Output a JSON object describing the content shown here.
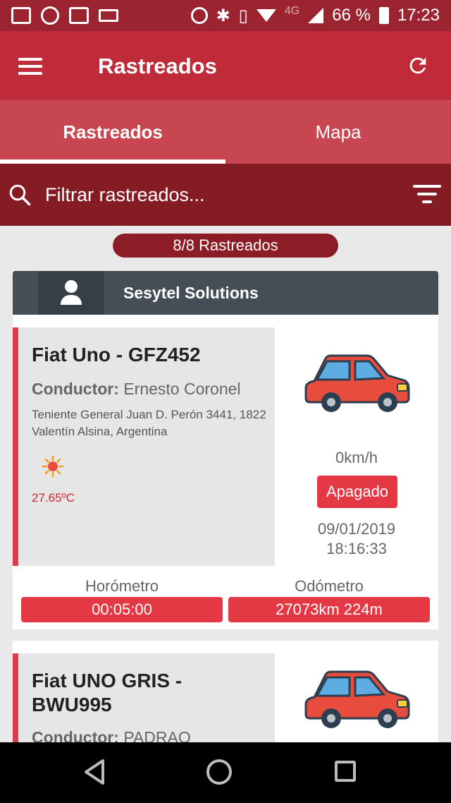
{
  "status_bar": {
    "network": "4G",
    "battery": "66 %",
    "time": "17:23",
    "icons": [
      "gmail-icon",
      "lock-app-icon",
      "image-icon",
      "laptop-icon",
      "data-saver-icon",
      "bluetooth-icon",
      "vibrate-icon",
      "wifi-icon",
      "signal-icon",
      "battery-icon"
    ]
  },
  "appbar": {
    "title": "Rastreados",
    "menu_icon": "hamburger-icon",
    "refresh_icon": "refresh-icon"
  },
  "tabs": [
    {
      "label": "Rastreados",
      "active": true
    },
    {
      "label": "Mapa",
      "active": false
    }
  ],
  "search": {
    "placeholder": "Filtrar rastreados...",
    "icon": "search-icon",
    "filter_icon": "filter-icon"
  },
  "count": "8/8 Rastreados",
  "group": {
    "name": "Sesytel Solutions",
    "icon": "user-icon"
  },
  "vehicles": [
    {
      "name": "Fiat Uno - GFZ452",
      "driver_label": "Conductor:",
      "driver": "Ernesto Coronel",
      "address": "Teniente General Juan D. Perón 3441, 1822 Valentín Alsina, Argentina",
      "weather_icon": "sun-icon",
      "temperature": "27.65ºC",
      "speed": "0km/h",
      "status": "Apagado",
      "date": "09/01/2019",
      "time": "18:16:33",
      "hourmeter_label": "Horómetro",
      "hourmeter": "00:05:00",
      "odometer_label": "Odómetro",
      "odometer": "27073km 224m",
      "accent_color": "#e53845"
    },
    {
      "name": "Fiat UNO GRIS - BWU995",
      "driver_label": "Conductor:",
      "driver": "PADRAO"
    }
  ],
  "colors": {
    "statusbar": "#9c2430",
    "appbar": "#bf2b38",
    "tabs": "#c74651",
    "search": "#851c24",
    "accent": "#e53845"
  }
}
